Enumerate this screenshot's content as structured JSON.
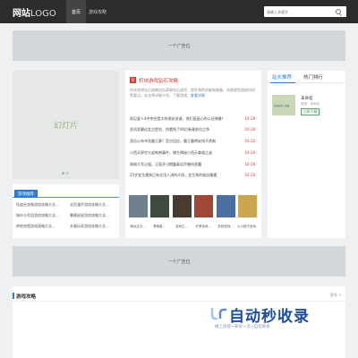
{
  "header": {
    "logo_bold": "网站",
    "logo_light": "LOGO",
    "nav": {
      "home": "首页",
      "games": "游戏攻略"
    },
    "search": {
      "placeholder": "请输入关键字"
    }
  },
  "ads": {
    "top": "一个广告位",
    "middle": "一个广告位"
  },
  "slideshow": {
    "label": "幻灯片"
  },
  "recommended": {
    "title": "游戏推荐",
    "items": [
      "怪盗社攻略游戏攻略大全...",
      "全民漫步游戏攻略大全...",
      "城市与军团游戏攻略大全...",
      "暴躁鼠鼠游戏攻略大全...",
      "绝地突围游戏攻略大全...",
      "夫妻玩家游戏攻略大全..."
    ]
  },
  "featured": {
    "badge": "荐",
    "title": "奶块游戏钻石攻略",
    "desc": "奶块游戏钻石攻略包括获取钻石途径、提升角色技能和装备、合理规划游戏时间等要点。本文将详细介绍，了解游戏...",
    "more": "查看详情"
  },
  "news": [
    {
      "title": "再见爱人4中李合是大的演技关键，他们直面心的公证弹播！",
      "date": "10-28"
    },
    {
      "title": "金项奖最佳女主提名，你猜到了00后新星前位之争",
      "date": "10-28"
    },
    {
      "title": "凌员公布冲洗霸王赛？官方回应，霸王霸将安排不然制",
      "date": "10-28"
    },
    {
      "title": "小西天探空大叔刺刺事件，博主揭秘小西天尊道之谜",
      "date": "10-28"
    },
    {
      "title": "网络大军过道，正面开讨揭露真实声誉的恶魔",
      "date": "10-28"
    },
    {
      "title": "25岁女生遭到已有业用人讲听大阳，女生帮的秘自遭遇",
      "date": "10-28"
    }
  ],
  "thumbs": [
    {
      "caption": "单仙生长...",
      "color": "#6e7f8d"
    },
    {
      "caption": "黑暗星...",
      "color": "#3f4a3f"
    },
    {
      "caption": "游戏王...",
      "color": "#4a3a30"
    },
    {
      "caption": "开罗游戏...",
      "color": "#a04836"
    },
    {
      "caption": "苏铁游戏...",
      "color": "#4b6fa0"
    },
    {
      "caption": "火小镇子游戏...",
      "color": "#caa64e"
    }
  ],
  "side": {
    "tabs": [
      "站长推荐",
      "热门排行"
    ],
    "item": {
      "thumb_label": "游戏名称 | 攻略",
      "name": "未命名",
      "category": "类别：未命名",
      "button": "立即下载"
    }
  },
  "section": {
    "title": "游戏攻略",
    "more": "更多 >"
  },
  "watermark": {
    "main": "自动秒收录",
    "sub": "做上链接→来访一次→自动收录"
  },
  "colors": {
    "header_bg": "#2c2c2c",
    "accent_blue": "#2d7bd4",
    "news_date": "#dd4444",
    "featured_title": "#c83a30"
  }
}
